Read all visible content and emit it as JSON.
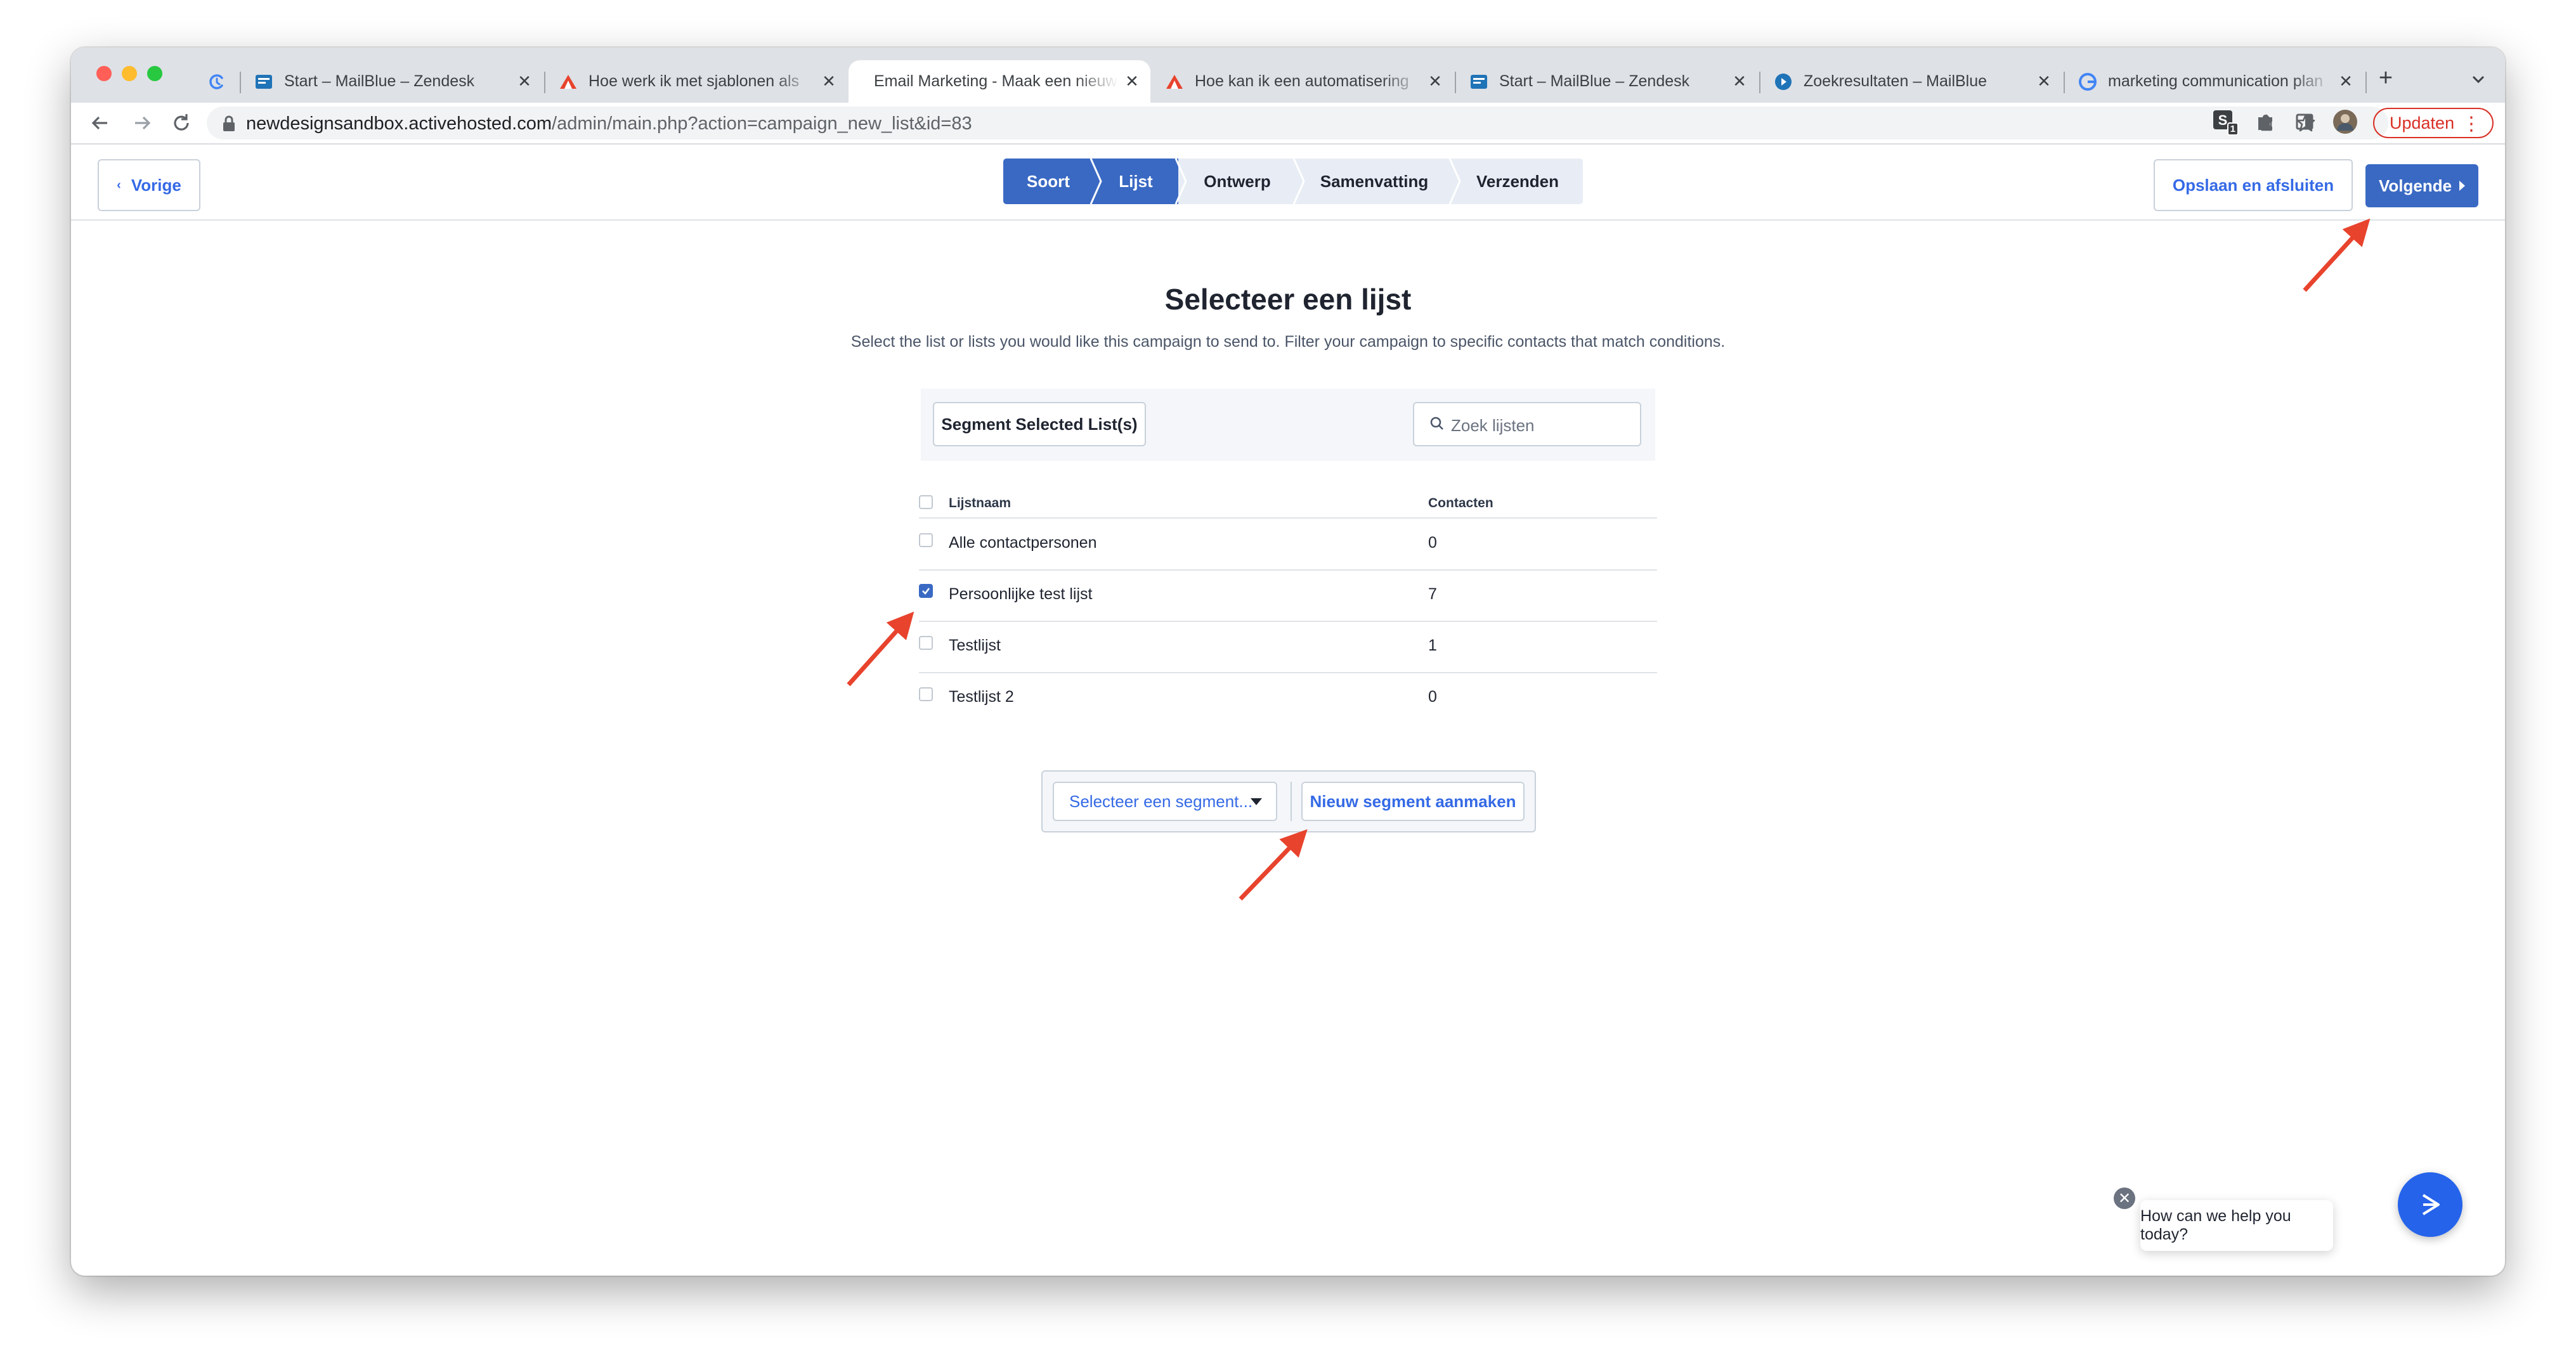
{
  "browser": {
    "tabs": [
      {
        "title": "",
        "icon": "history-icon"
      },
      {
        "title": "Start – MailBlue – Zendesk",
        "icon": "zendesk-icon"
      },
      {
        "title": "Hoe werk ik met sjablonen als",
        "icon": "mailblue-icon"
      },
      {
        "title": "Email Marketing - Maak een nieuwe campagne",
        "icon": "none",
        "active": true
      },
      {
        "title": "Hoe kan ik een automatisering",
        "icon": "mailblue-icon"
      },
      {
        "title": "Start – MailBlue – Zendesk",
        "icon": "zendesk-icon"
      },
      {
        "title": "Zoekresultaten – MailBlue",
        "icon": "search-result-icon"
      },
      {
        "title": "marketing communication plan",
        "icon": "google-icon"
      }
    ],
    "url_host": "newdesignsandbox.activehosted.com",
    "url_path": "/admin/main.php?action=campaign_new_list&id=83",
    "ext_badge": "1",
    "update_label": "Updaten"
  },
  "header": {
    "back_label": "Vorige",
    "steps": [
      "Soort",
      "Lijst",
      "Ontwerp",
      "Samenvatting",
      "Verzenden"
    ],
    "active_step": "Lijst",
    "save_close_label": "Opslaan en afsluiten",
    "next_label": "Volgende"
  },
  "main": {
    "title": "Selecteer een lijst",
    "subtitle": "Select the list or lists you would like this campaign to send to. Filter your campaign to specific contacts that match conditions.",
    "segment_selected_label": "Segment Selected List(s)",
    "search_placeholder": "Zoek lijsten",
    "table": {
      "headers": {
        "name": "Lijstnaam",
        "contacts": "Contacten"
      },
      "rows": [
        {
          "name": "Alle contactpersonen",
          "contacts": "0",
          "checked": false
        },
        {
          "name": "Persoonlijke test lijst",
          "contacts": "7",
          "checked": true
        },
        {
          "name": "Testlijst",
          "contacts": "1",
          "checked": false
        },
        {
          "name": "Testlijst 2",
          "contacts": "0",
          "checked": false
        }
      ]
    },
    "segment_select_label": "Selecteer een segment...",
    "new_segment_label": "Nieuw segment aanmaken"
  },
  "chat": {
    "message": "How can we help you today?"
  },
  "colors": {
    "accent": "#3a69c3",
    "link": "#356ae6",
    "annotation_arrow": "#e8432d",
    "chat_button": "#2563eb"
  }
}
